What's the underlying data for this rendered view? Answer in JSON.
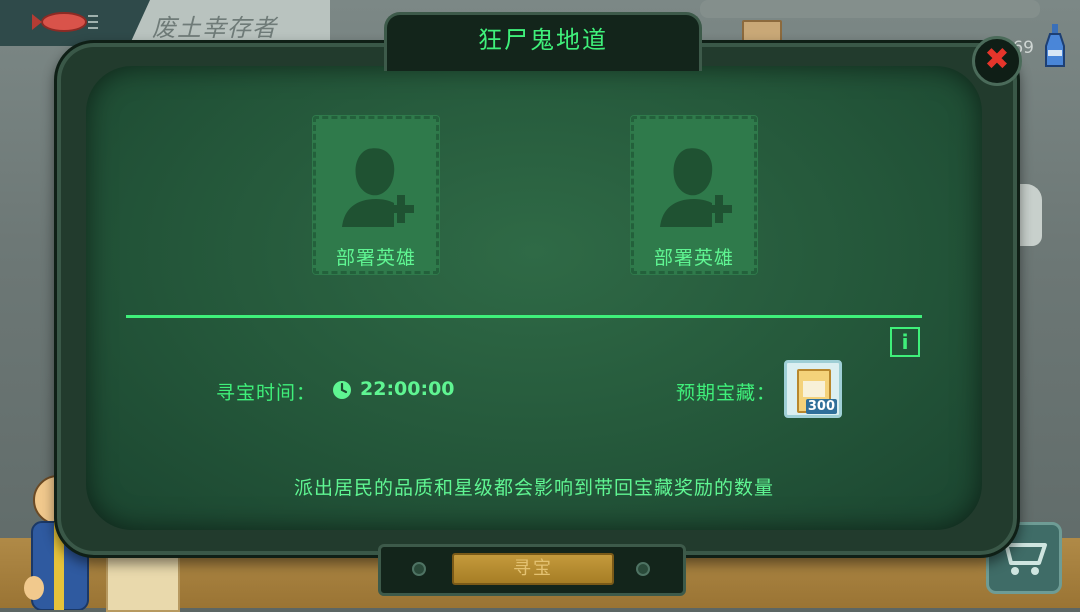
{
  "background": {
    "shelter_name": "废土幸存者",
    "counter": "69"
  },
  "dialog": {
    "title": "狂尸鬼地道",
    "close_icon": "close-icon",
    "hero_slots": [
      {
        "label": "部署英雄",
        "icon": "add-hero-icon"
      },
      {
        "label": "部署英雄",
        "icon": "add-hero-icon"
      }
    ],
    "info_label": "i",
    "search_time_label": "寻宝时间：",
    "search_time_value": "22:00:00",
    "expected_reward_label": "预期宝藏：",
    "reward": {
      "quantity": "300",
      "icon": "cereal-box-icon"
    },
    "note": "派出居民的品质和星级都会影响到带回宝藏奖励的数量",
    "search_button": "寻宝"
  },
  "colors": {
    "accent": "#3ff07a",
    "panel": "#24573a",
    "close": "#e5352b",
    "button": "#b08a2e"
  }
}
